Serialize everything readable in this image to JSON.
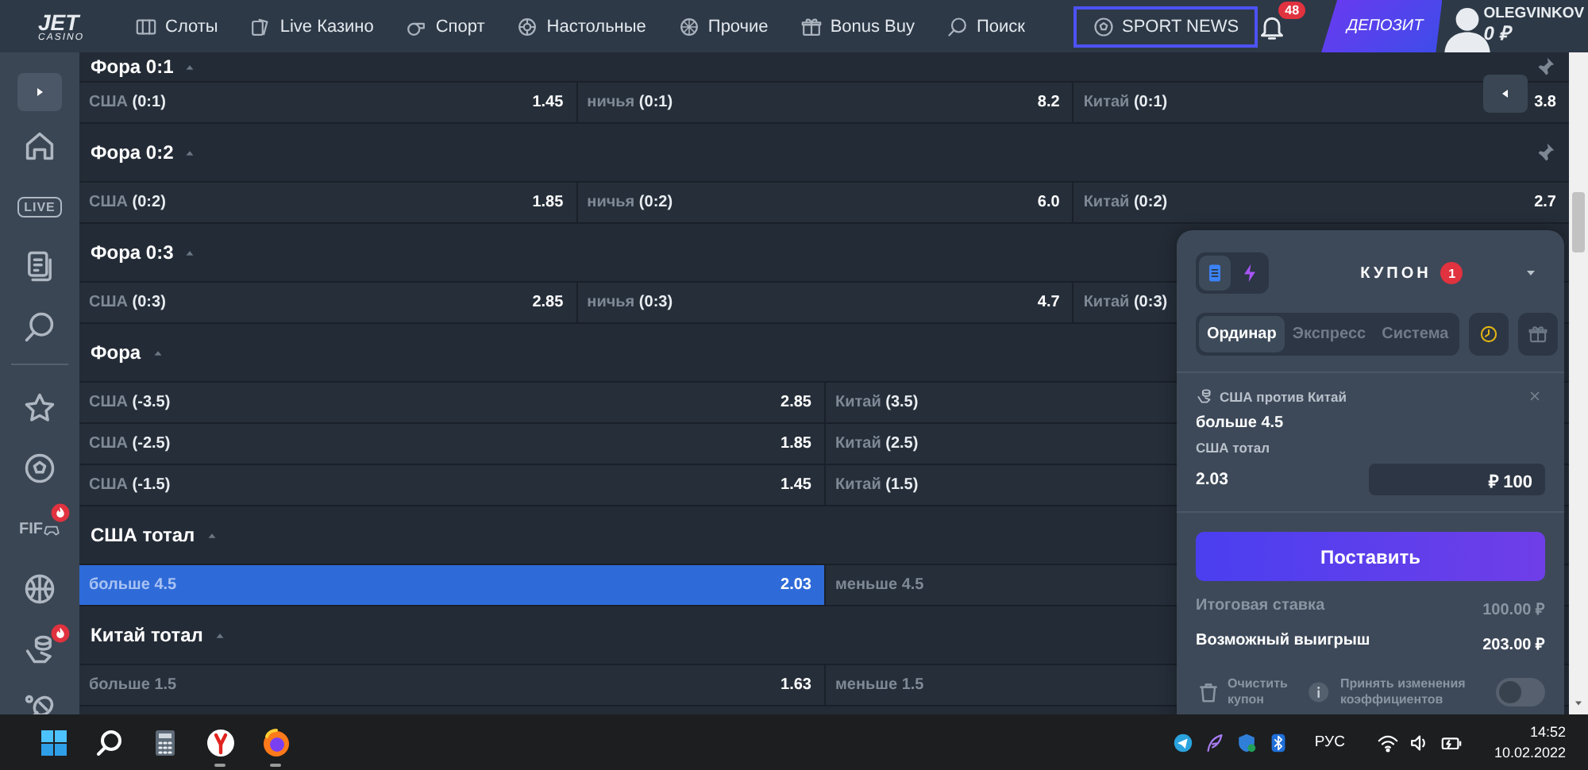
{
  "header": {
    "logo": {
      "title": "JET",
      "subtitle": "CASINO"
    },
    "nav": [
      {
        "kind": "slots",
        "label": "Слоты",
        "highlighted": false
      },
      {
        "kind": "live-casino",
        "label": "Live Казино",
        "highlighted": false
      },
      {
        "kind": "sport",
        "label": "Спорт",
        "highlighted": false
      },
      {
        "kind": "table-games",
        "label": "Настольные",
        "highlighted": false
      },
      {
        "kind": "other",
        "label": "Прочие",
        "highlighted": false
      },
      {
        "kind": "bonus",
        "label": "Bonus Buy",
        "highlighted": false
      },
      {
        "kind": "search",
        "label": "Поиск",
        "highlighted": false
      },
      {
        "kind": "news",
        "label": "SPORT NEWS",
        "highlighted": true
      }
    ],
    "notifications": "48",
    "deposit_button": "ДЕПОЗИТ",
    "user": {
      "name": "OLEGVINKOV",
      "balance": "0 ₽"
    }
  },
  "sidebar": {
    "items": [
      {
        "kind": "expand",
        "hot": false
      },
      {
        "kind": "home",
        "hot": false
      },
      {
        "kind": "live",
        "label": "LIVE",
        "hot": false
      },
      {
        "kind": "coupons",
        "hot": false
      },
      {
        "kind": "search",
        "hot": false
      },
      {
        "kind": "divider",
        "hot": false
      },
      {
        "kind": "favorites",
        "hot": false
      },
      {
        "kind": "football",
        "hot": false
      },
      {
        "kind": "fifa",
        "label": "FIF",
        "hot": true
      },
      {
        "kind": "basketball",
        "hot": false
      },
      {
        "kind": "esports",
        "hot": true
      },
      {
        "kind": "tennis",
        "hot": false
      }
    ]
  },
  "markets": [
    {
      "title": "Фора 0:1",
      "expanded": true,
      "pinned": true,
      "rows": [
        {
          "cells": [
            {
              "label": "США **(0:1)**",
              "odd": "1.45",
              "selected": false
            },
            {
              "label": "ничья **(0:1)**",
              "odd": "8.2",
              "selected": false
            },
            {
              "label": "Китай **(0:1)**",
              "odd": "3.8",
              "selected": false
            }
          ]
        }
      ]
    },
    {
      "title": "Фора 0:2",
      "expanded": true,
      "pinned": true,
      "rows": [
        {
          "cells": [
            {
              "label": "США **(0:2)**",
              "odd": "1.85",
              "selected": false
            },
            {
              "label": "ничья **(0:2)**",
              "odd": "6.0",
              "selected": false
            },
            {
              "label": "Китай **(0:2)**",
              "odd": "2.7",
              "selected": false
            }
          ]
        }
      ]
    },
    {
      "title": "Фора 0:3",
      "expanded": true,
      "pinned": false,
      "rows": [
        {
          "cells": [
            {
              "label": "США **(0:3)**",
              "odd": "2.85",
              "selected": false
            },
            {
              "label": "ничья **(0:3)**",
              "odd": "4.7",
              "selected": false
            },
            {
              "label": "Китай **(0:3)**",
              "selected": false
            }
          ]
        }
      ]
    },
    {
      "title": "Фора",
      "expanded": true,
      "pinned": false,
      "rows": [
        {
          "cells": [
            {
              "label": "США **(-3.5)**",
              "odd": "2.85",
              "selected": false
            },
            {
              "label": "Китай **(3.5)**",
              "selected": false
            }
          ]
        },
        {
          "cells": [
            {
              "label": "США **(-2.5)**",
              "odd": "1.85",
              "selected": false
            },
            {
              "label": "Китай **(2.5)**",
              "selected": false
            }
          ]
        },
        {
          "cells": [
            {
              "label": "США **(-1.5)**",
              "odd": "1.45",
              "selected": false
            },
            {
              "label": "Китай **(1.5)**",
              "selected": false
            }
          ]
        }
      ]
    },
    {
      "title": "США тотал",
      "expanded": true,
      "pinned": false,
      "rows": [
        {
          "cells": [
            {
              "label": "больше 4.5",
              "odd": "2.03",
              "selected": true
            },
            {
              "label": "меньше 4.5",
              "selected": false
            }
          ]
        }
      ]
    },
    {
      "title": "Китай тотал",
      "expanded": true,
      "pinned": false,
      "rows": [
        {
          "cells": [
            {
              "label": "больше 1.5",
              "odd": "1.63",
              "selected": false
            },
            {
              "label": "меньше 1.5",
              "selected": false
            }
          ]
        }
      ]
    }
  ],
  "coupon": {
    "modes": [
      {
        "kind": "list",
        "selected": true
      },
      {
        "kind": "quick",
        "selected": false
      }
    ],
    "title": "КУПОН",
    "count": "1",
    "tabs": [
      {
        "label": "Ординар",
        "selected": true
      },
      {
        "label": "Экспресс",
        "selected": false
      },
      {
        "label": "Система",
        "selected": false
      }
    ],
    "bet": {
      "event": "США против Китай",
      "selection": "больше 4.5",
      "market": "США тотал",
      "odd": "2.03",
      "stake": "₽ 100"
    },
    "place_button": "Поставить",
    "summary": [
      {
        "label": "Итоговая ставка",
        "value": "100.00 ₽",
        "emphasis": false
      },
      {
        "label": "Возможный выигрыш",
        "value": "203.00 ₽",
        "emphasis": true
      }
    ],
    "clear_button": "Очистить купон",
    "accept_changes": {
      "label": "Принять изменения коэффициентов",
      "on": false
    }
  },
  "taskbar": {
    "apps": [
      {
        "kind": "start",
        "running": false
      },
      {
        "kind": "search",
        "running": false
      },
      {
        "kind": "calculator",
        "running": false
      },
      {
        "kind": "round-logo",
        "running": true
      },
      {
        "kind": "orb-logo",
        "running": true
      }
    ],
    "tray": [
      {
        "kind": "telegram"
      },
      {
        "kind": "feather"
      },
      {
        "kind": "shield"
      },
      {
        "kind": "bluetooth"
      }
    ],
    "language": "РУС",
    "status": [
      {
        "kind": "wifi"
      },
      {
        "kind": "volume"
      },
      {
        "kind": "battery"
      }
    ],
    "time": "14:52",
    "date": "10.02.2022"
  }
}
